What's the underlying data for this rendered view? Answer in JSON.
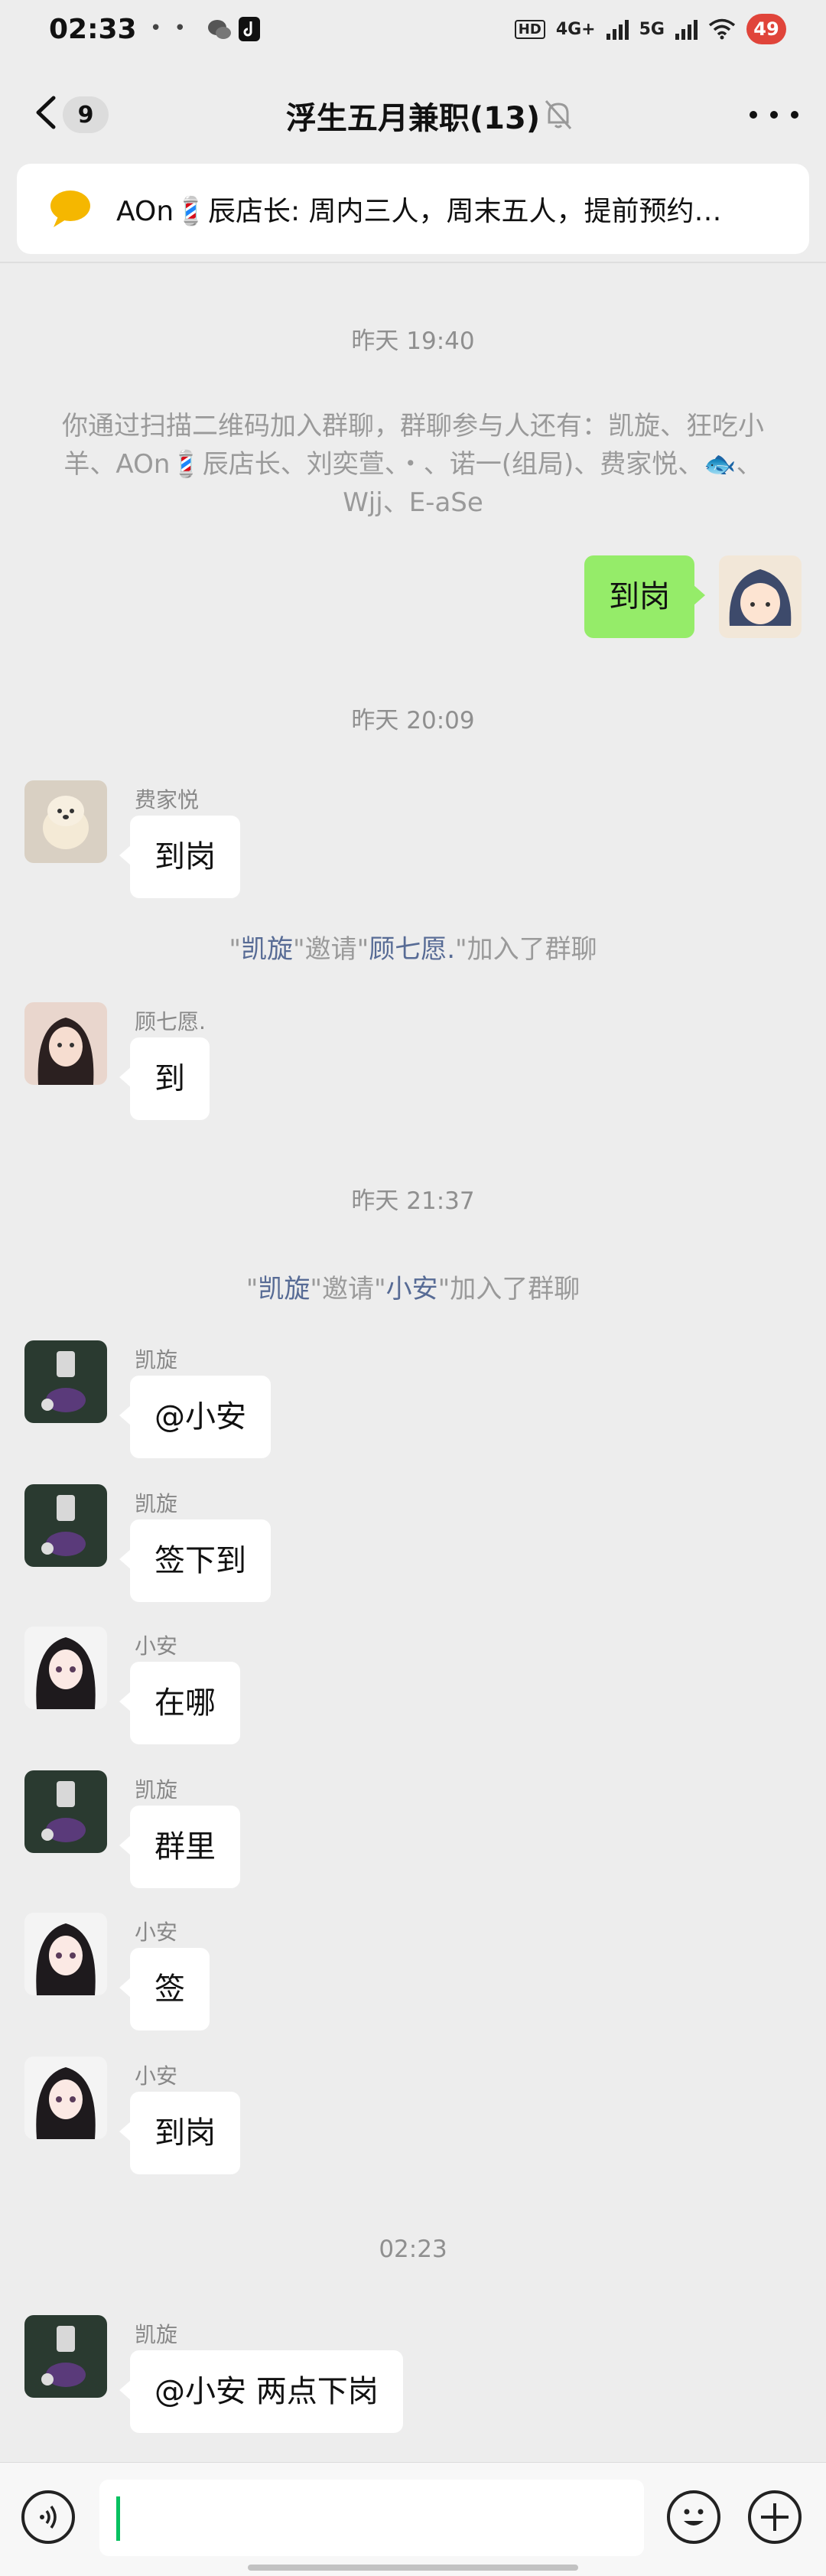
{
  "status_bar": {
    "time": "02:33",
    "notif_dots": "• • ",
    "hd_label": "HD",
    "net1": "4G+",
    "net2": "5G",
    "battery": "49"
  },
  "header": {
    "unread_count": "9",
    "title": "浮生五月兼职(13)"
  },
  "pinned": {
    "text": "AOn💈辰店长: 周内三人，周末五人，提前预约…"
  },
  "chat": {
    "stamp1": "昨天 19:40",
    "join_notice": "你通过扫描二维码加入群聊，群聊参与人还有：凯旋、狂吃小羊、AOn💈辰店长、刘奕萱、・、诺一(组局)、费家悦、🐟、Wjj、E-aSe",
    "me_msg": "到岗",
    "stamp2": "昨天 20:09",
    "msg_fei": {
      "name": "费家悦",
      "text": "到岗"
    },
    "invite1": {
      "q1": "\"",
      "inviter": "凯旋",
      "mid": "\"邀请\"",
      "invitee": "顾七愿.",
      "end": "\"加入了群聊"
    },
    "msg_gu": {
      "name": "顾七愿.",
      "text": "到"
    },
    "stamp3": "昨天 21:37",
    "invite2": {
      "q1": "\"",
      "inviter": "凯旋",
      "mid": "\"邀请\"",
      "invitee": "小安",
      "end": "\"加入了群聊"
    },
    "msg_k1": {
      "name": "凯旋",
      "text": "@小安"
    },
    "msg_k2": {
      "name": "凯旋",
      "text": "签下到"
    },
    "msg_a1": {
      "name": "小安",
      "text": "在哪"
    },
    "msg_k3": {
      "name": "凯旋",
      "text": "群里"
    },
    "msg_a2": {
      "name": "小安",
      "text": "签"
    },
    "msg_a3": {
      "name": "小安",
      "text": "到岗"
    },
    "stamp4": "02:23",
    "msg_k4": {
      "name": "凯旋",
      "text": "@小安  两点下岗"
    }
  },
  "input": {
    "value": ""
  },
  "colors": {
    "self_bubble": "#95ec69",
    "link_blue": "#576b95",
    "accent_green": "#07c160",
    "background": "#ededed"
  }
}
